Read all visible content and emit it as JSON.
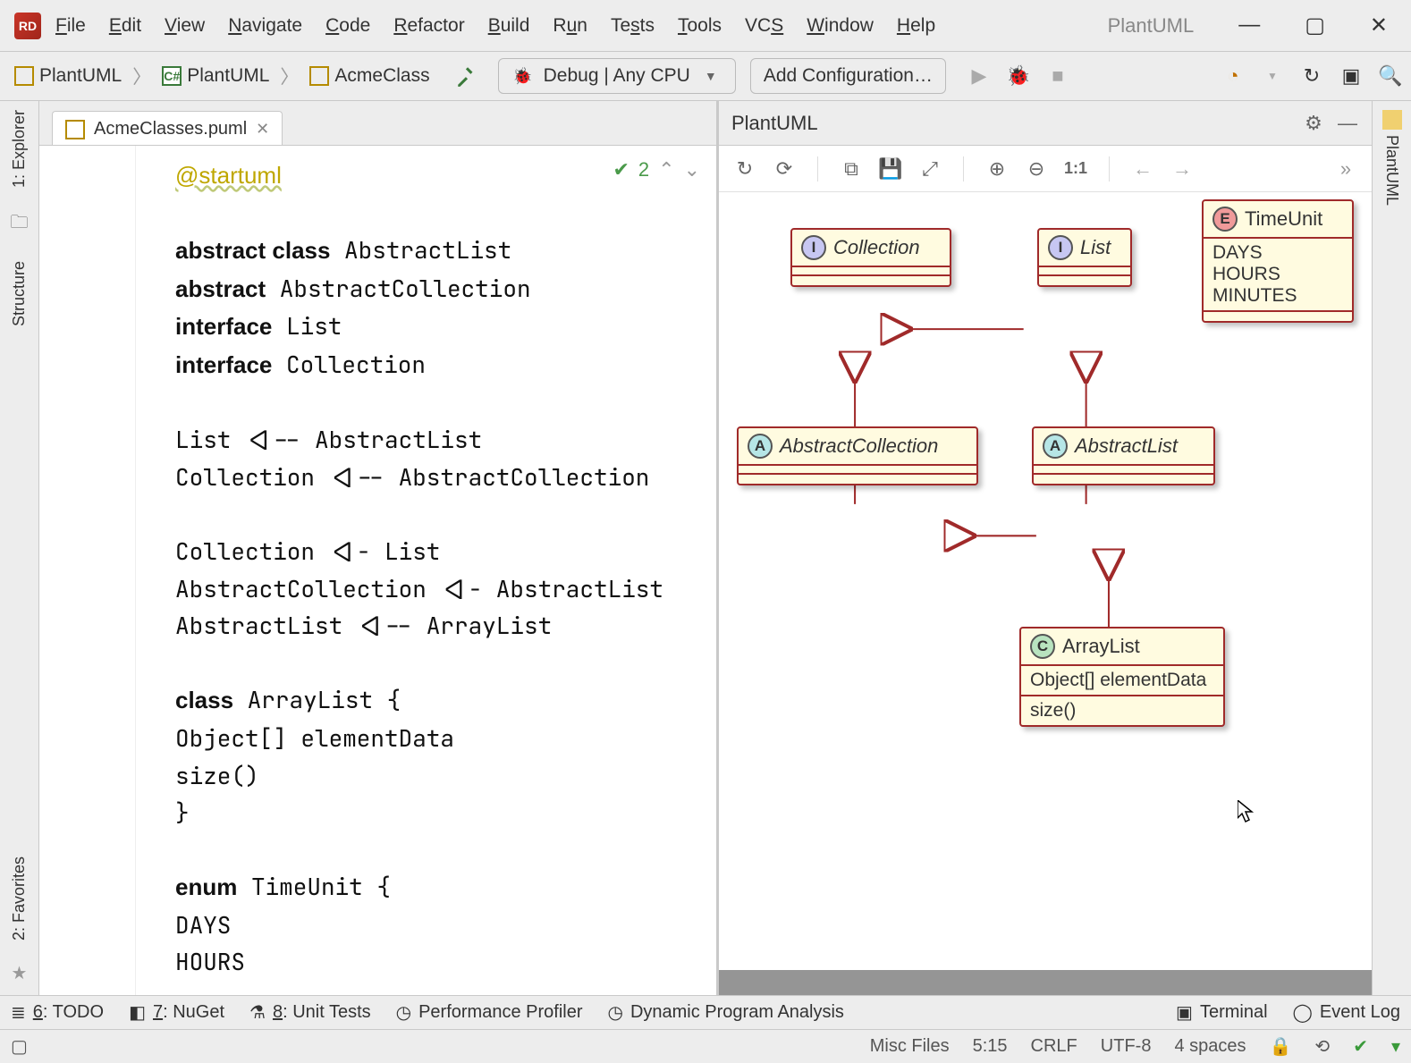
{
  "window": {
    "app_badge": "RD",
    "title_hint": "PlantUML"
  },
  "menu": {
    "file": "File",
    "edit": "Edit",
    "view": "View",
    "navigate": "Navigate",
    "code": "Code",
    "refactor": "Refactor",
    "build": "Build",
    "run": "Run",
    "tests": "Tests",
    "tools": "Tools",
    "vcs": "VCS",
    "window": "Window",
    "help": "Help"
  },
  "breadcrumbs": {
    "a": "PlantUML",
    "b": "PlantUML",
    "c": "AcmeClass"
  },
  "run": {
    "config_label": "Debug | Any CPU",
    "add_config": "Add Configuration…"
  },
  "tab": {
    "filename": "AcmeClasses.puml"
  },
  "inspection": {
    "count": "2"
  },
  "code_lines": [
    {
      "t": "ann",
      "v": "@startuml"
    },
    {
      "t": "blank"
    },
    {
      "t": "kw2",
      "k": "abstract class",
      "v": "AbstractList"
    },
    {
      "t": "kw",
      "k": "abstract",
      "v": "AbstractCollection"
    },
    {
      "t": "kw",
      "k": "interface",
      "v": "List"
    },
    {
      "t": "kw",
      "k": "interface",
      "v": "Collection"
    },
    {
      "t": "blank"
    },
    {
      "t": "plain",
      "v": "List <|-- AbstractList"
    },
    {
      "t": "plain",
      "v": "Collection <|-- AbstractCollection"
    },
    {
      "t": "blank"
    },
    {
      "t": "plain",
      "v": "Collection <|- List"
    },
    {
      "t": "plain",
      "v": "AbstractCollection <|- AbstractList"
    },
    {
      "t": "plain",
      "v": "AbstractList <|-- ArrayList"
    },
    {
      "t": "blank"
    },
    {
      "t": "kw",
      "k": "class",
      "v": "ArrayList {"
    },
    {
      "t": "plain",
      "v": "Object[] elementData"
    },
    {
      "t": "plain",
      "v": "size()"
    },
    {
      "t": "plain",
      "v": "}"
    },
    {
      "t": "blank"
    },
    {
      "t": "kw",
      "k": "enum",
      "v": "TimeUnit {"
    },
    {
      "t": "plain",
      "v": "DAYS"
    },
    {
      "t": "plain",
      "v": "HOURS"
    }
  ],
  "preview": {
    "title": "PlantUML"
  },
  "uml": {
    "collection": {
      "name": "Collection",
      "stereo": "I"
    },
    "list": {
      "name": "List",
      "stereo": "I"
    },
    "abscoll": {
      "name": "AbstractCollection",
      "stereo": "A"
    },
    "abslist": {
      "name": "AbstractList",
      "stereo": "A"
    },
    "arraylist": {
      "name": "ArrayList",
      "stereo": "C",
      "field": "Object[] elementData",
      "method": "size()"
    },
    "timeunit": {
      "name": "TimeUnit",
      "stereo": "E",
      "v1": "DAYS",
      "v2": "HOURS",
      "v3": "MINUTES"
    }
  },
  "left_rail": {
    "explorer": "1: Explorer",
    "structure": "Structure",
    "favorites": "2: Favorites"
  },
  "right_rail": {
    "plantuml": "PlantUML"
  },
  "bottom": {
    "todo": "6: TODO",
    "nuget": "7: NuGet",
    "unit": "8: Unit Tests",
    "perf": "Performance Profiler",
    "dpa": "Dynamic Program Analysis",
    "term": "Terminal",
    "log": "Event Log"
  },
  "status": {
    "ctx": "Misc Files",
    "pos": "5:15",
    "eol": "CRLF",
    "enc": "UTF-8",
    "indent": "4 spaces"
  },
  "zoom_label": "1:1"
}
